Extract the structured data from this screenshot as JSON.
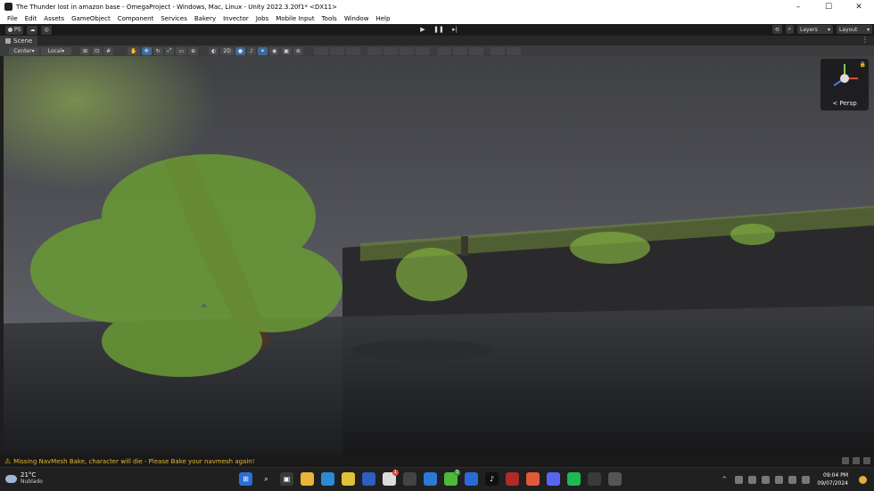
{
  "window": {
    "title": "The Thunder lost in amazon base - OmegaProject - Windows, Mac, Linux - Unity 2022.3.20f1* <DX11>",
    "minimize": "–",
    "maximize": "☐",
    "close": "✕"
  },
  "menu": [
    "File",
    "Edit",
    "Assets",
    "GameObject",
    "Component",
    "Services",
    "Bakery",
    "Invector",
    "Jobs",
    "Mobile Input",
    "Tools",
    "Window",
    "Help"
  ],
  "toolbar": {
    "account": "PS",
    "layers": "Layers",
    "layout": "Layout"
  },
  "scene": {
    "tab_label": "Scene",
    "pivot": "Center",
    "space": "Local",
    "mode_2d": "2D",
    "gizmo_label": "< Persp"
  },
  "status": {
    "message": "Missing NavMesh Bake, character will die - Please Bake your navmesh again!",
    "color": "#e6b82e"
  },
  "taskbar": {
    "temperature": "21°C",
    "condition": "Nublado",
    "time": "09:04 PM",
    "date": "09/07/2024",
    "badges": {
      "app8": "1",
      "app11": "3"
    }
  }
}
